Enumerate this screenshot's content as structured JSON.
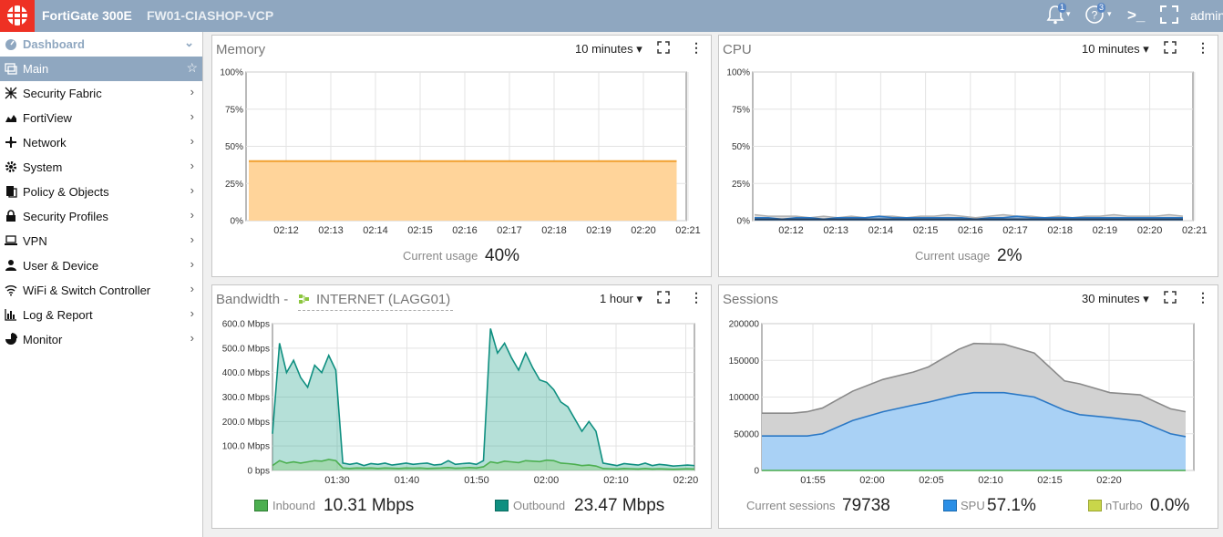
{
  "topbar": {
    "product": "FortiGate 300E",
    "hostname": "FW01-CIASHOP-VCP",
    "alerts_count": "1",
    "help_count": "3",
    "user": "admin",
    "cli_glyph": ">_"
  },
  "sidebar": {
    "header": "Dashboard",
    "items": [
      {
        "label": "Main",
        "icon": "dashboard-icon",
        "active": true
      },
      {
        "label": "Security Fabric",
        "icon": "fabric-icon"
      },
      {
        "label": "FortiView",
        "icon": "chart-icon"
      },
      {
        "label": "Network",
        "icon": "network-icon"
      },
      {
        "label": "System",
        "icon": "gear-icon"
      },
      {
        "label": "Policy & Objects",
        "icon": "policy-icon"
      },
      {
        "label": "Security Profiles",
        "icon": "lock-icon"
      },
      {
        "label": "VPN",
        "icon": "laptop-icon"
      },
      {
        "label": "User & Device",
        "icon": "user-icon"
      },
      {
        "label": "WiFi & Switch Controller",
        "icon": "wifi-icon"
      },
      {
        "label": "Log & Report",
        "icon": "bar-chart-icon"
      },
      {
        "label": "Monitor",
        "icon": "pie-chart-icon"
      }
    ]
  },
  "memory": {
    "title": "Memory",
    "range": "10 minutes",
    "current_label": "Current usage",
    "current_value": "40%",
    "chart_data": {
      "type": "area",
      "y_ticks": [
        "100%",
        "75%",
        "50%",
        "25%",
        "0%"
      ],
      "ylim": [
        0,
        100
      ],
      "x_ticks": [
        "02:12",
        "02:13",
        "02:14",
        "02:15",
        "02:16",
        "02:17",
        "02:18",
        "02:19",
        "02:20",
        "02:21"
      ],
      "series": [
        {
          "name": "Memory",
          "color": "#f5a340",
          "x": [
            0,
            9.5
          ],
          "values": [
            40,
            40
          ]
        }
      ]
    }
  },
  "cpu": {
    "title": "CPU",
    "range": "10 minutes",
    "current_label": "Current usage",
    "current_value": "2%",
    "chart_data": {
      "type": "area",
      "y_ticks": [
        "100%",
        "75%",
        "50%",
        "25%",
        "0%"
      ],
      "ylim": [
        0,
        100
      ],
      "x_ticks": [
        "02:12",
        "02:13",
        "02:14",
        "02:15",
        "02:16",
        "02:17",
        "02:18",
        "02:19",
        "02:20",
        "02:21"
      ],
      "series": [
        {
          "color": "#aaaaaa",
          "values": [
            4,
            3,
            3,
            3,
            2,
            3,
            2,
            3,
            2,
            3,
            3,
            2,
            3,
            3,
            4,
            3,
            2,
            3,
            4,
            3,
            3,
            2,
            3,
            2,
            3,
            3,
            4,
            3,
            3,
            3,
            4,
            3
          ]
        },
        {
          "color": "#2b78c5",
          "values": [
            2,
            2,
            1,
            2,
            2,
            1,
            2,
            2,
            2,
            3,
            2,
            2,
            2,
            2,
            2,
            2,
            1,
            2,
            2,
            3,
            2,
            2,
            2,
            2,
            2,
            2,
            2,
            2,
            2,
            2,
            2,
            2
          ]
        },
        {
          "color": "#1f3a5a",
          "values": [
            1,
            1,
            1,
            1,
            1,
            1,
            1,
            1,
            1,
            1,
            1,
            1,
            1,
            1,
            1,
            1,
            1,
            1,
            1,
            1,
            1,
            1,
            1,
            1,
            1,
            1,
            1,
            1,
            1,
            1,
            1,
            1
          ]
        }
      ]
    }
  },
  "bandwidth": {
    "title": "Bandwidth - ",
    "interface": "INTERNET (LAGG01)",
    "range": "1 hour",
    "inbound_label": "Inbound",
    "inbound_value": "10.31 Mbps",
    "inbound_color": "#4caf50",
    "outbound_label": "Outbound",
    "outbound_value": "23.47 Mbps",
    "outbound_color": "#0f8f80",
    "chart_data": {
      "type": "area",
      "unit": "Mbps",
      "ylim": [
        0,
        600
      ],
      "y_ticks": [
        "600.0 Mbps",
        "500.0 Mbps",
        "400.0 Mbps",
        "300.0 Mbps",
        "200.0 Mbps",
        "100.0 Mbps",
        "0 bps"
      ],
      "x_ticks": [
        "01:30",
        "01:40",
        "01:50",
        "02:00",
        "02:10",
        "02:20"
      ],
      "x": [
        0,
        1,
        2,
        3,
        4,
        5,
        6,
        7,
        8,
        9,
        10,
        11,
        12,
        13,
        14,
        15,
        16,
        17,
        18,
        19,
        20,
        21,
        22,
        23,
        24,
        25,
        26,
        27,
        28,
        29,
        30,
        31,
        32,
        33,
        34,
        35,
        36,
        37,
        38,
        39,
        40,
        41,
        42,
        43,
        44,
        45,
        46,
        47,
        48,
        49,
        50,
        51,
        52,
        53,
        54,
        55,
        56,
        57,
        58,
        59,
        60
      ],
      "series": [
        {
          "name": "Outbound",
          "values": [
            150,
            520,
            400,
            450,
            380,
            340,
            430,
            400,
            470,
            410,
            30,
            25,
            30,
            20,
            28,
            25,
            30,
            22,
            26,
            30,
            25,
            28,
            30,
            22,
            25,
            40,
            25,
            28,
            30,
            25,
            40,
            580,
            480,
            520,
            460,
            410,
            480,
            420,
            370,
            360,
            330,
            280,
            260,
            210,
            160,
            200,
            160,
            30,
            25,
            20,
            28,
            25,
            22,
            30,
            20,
            25,
            22,
            18,
            20,
            22,
            20
          ]
        },
        {
          "name": "Inbound",
          "values": [
            20,
            40,
            30,
            35,
            30,
            35,
            40,
            38,
            45,
            40,
            10,
            8,
            10,
            9,
            10,
            8,
            10,
            9,
            8,
            10,
            9,
            10,
            8,
            9,
            10,
            12,
            9,
            10,
            12,
            10,
            15,
            35,
            30,
            38,
            35,
            32,
            40,
            38,
            36,
            42,
            40,
            30,
            28,
            25,
            20,
            22,
            18,
            8,
            7,
            6,
            8,
            7,
            6,
            8,
            6,
            7,
            6,
            5,
            6,
            7,
            6
          ]
        }
      ]
    }
  },
  "sessions": {
    "title": "Sessions",
    "range": "30 minutes",
    "current_label": "Current sessions",
    "current_value": "79738",
    "spu_label": "SPU",
    "spu_value": "57.1%",
    "spu_color": "#2b8fe6",
    "nturbo_label": "nTurbo",
    "nturbo_value": "0.0%",
    "nturbo_color": "#c9d64a",
    "chart_data": {
      "type": "area",
      "ylim": [
        0,
        200000
      ],
      "y_ticks": [
        "200000",
        "150000",
        "100000",
        "50000",
        "0"
      ],
      "x_ticks": [
        "01:55",
        "02:00",
        "02:05",
        "02:10",
        "02:15",
        "02:20"
      ],
      "x": [
        -2,
        0,
        1,
        2,
        4,
        6,
        8,
        9,
        11,
        12,
        14,
        16,
        18,
        19,
        21,
        23,
        25,
        26
      ],
      "series": [
        {
          "name": "Current sessions",
          "values": [
            78000,
            78000,
            80000,
            85000,
            108000,
            124000,
            134000,
            141000,
            165000,
            173000,
            172000,
            160000,
            122000,
            118000,
            106000,
            103000,
            84000,
            80000
          ]
        },
        {
          "name": "SPU",
          "values": [
            47000,
            47000,
            47000,
            50000,
            68000,
            80000,
            89000,
            93000,
            103000,
            106000,
            106000,
            100000,
            82000,
            76000,
            72000,
            67000,
            50000,
            46000
          ]
        },
        {
          "name": "nTurbo",
          "values": [
            0,
            0,
            0,
            0,
            0,
            0,
            0,
            0,
            0,
            0,
            0,
            0,
            0,
            0,
            0,
            0,
            0,
            0
          ]
        }
      ]
    }
  }
}
